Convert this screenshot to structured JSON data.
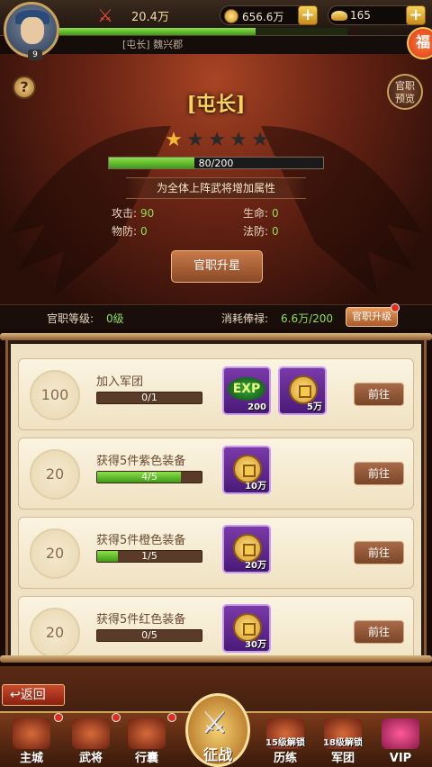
{
  "header": {
    "avatar_level": "9",
    "power": "20.4万",
    "coins": "656.6万",
    "ingots": "165",
    "plus": "+",
    "exp_fraction": 0.68
  },
  "title_bar": {
    "text": "[屯长] 魏兴郡"
  },
  "rank": {
    "title": "[屯长]",
    "stars_total": 5,
    "stars_lit": 1,
    "progress_current": 80,
    "progress_max": 200,
    "progress_text": "80/200",
    "attr_banner": "为全体上阵武将增加属性",
    "stats": [
      {
        "label": "攻击:",
        "value": "90"
      },
      {
        "label": "生命:",
        "value": "0"
      },
      {
        "label": "物防:",
        "value": "0"
      },
      {
        "label": "法防:",
        "value": "0"
      }
    ],
    "upgrade_button": "官职升星",
    "help": "?",
    "preview_button": "官职预览",
    "corner_badge": "福"
  },
  "info_bar": {
    "level_label": "官职等级:",
    "level_value": "0级",
    "cost_label": "消耗俸禄:",
    "cost_value": "6.6万/200",
    "upgrade_button": "官职升级"
  },
  "tasks": [
    {
      "points": "100",
      "name": "加入军团",
      "current": 0,
      "max": 1,
      "progress_text": "0/1",
      "rewards": [
        {
          "type": "exp",
          "label": "EXP",
          "amount": "200"
        },
        {
          "type": "coin",
          "amount": "5万"
        }
      ],
      "button": "前往"
    },
    {
      "points": "20",
      "name": "获得5件紫色装备",
      "current": 4,
      "max": 5,
      "progress_text": "4/5",
      "rewards": [
        {
          "type": "coin",
          "amount": "10万"
        }
      ],
      "button": "前往"
    },
    {
      "points": "20",
      "name": "获得5件橙色装备",
      "current": 1,
      "max": 5,
      "progress_text": "1/5",
      "rewards": [
        {
          "type": "coin",
          "amount": "20万"
        }
      ],
      "button": "前往"
    },
    {
      "points": "20",
      "name": "获得5件红色装备",
      "current": 0,
      "max": 5,
      "progress_text": "0/5",
      "rewards": [
        {
          "type": "coin",
          "amount": "30万"
        }
      ],
      "button": "前往"
    }
  ],
  "bottom": {
    "back": "返回",
    "dock": [
      {
        "label": "主城",
        "lock": ""
      },
      {
        "label": "武将",
        "lock": ""
      },
      {
        "label": "行囊",
        "lock": ""
      },
      {
        "label": "征战",
        "lock": ""
      },
      {
        "label": "历练",
        "lock": "15级解锁"
      },
      {
        "label": "军团",
        "lock": "18级解锁"
      },
      {
        "label": "VIP",
        "lock": ""
      }
    ]
  }
}
